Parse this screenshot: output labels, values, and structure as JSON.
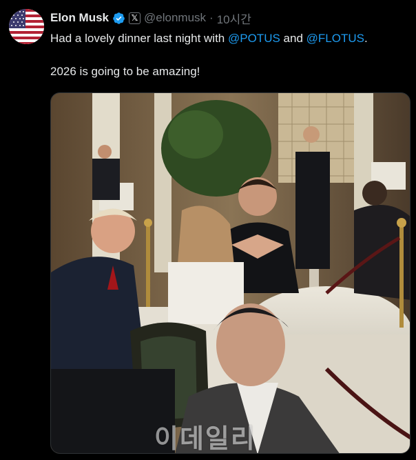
{
  "tweet": {
    "author_name": "Elon Musk",
    "handle": "@elonmusk",
    "separator": "·",
    "time": "10시간",
    "text_before": "Had a lovely dinner last night with ",
    "mention_1": "@POTUS",
    "text_and": " and ",
    "mention_2": "@FLOTUS",
    "text_end": ".",
    "line_2": "2026 is going to be amazing!"
  },
  "media": {
    "watermark": "이데일리"
  },
  "icons": {
    "avatar": "us-flag-avatar",
    "verified": "verified-badge-icon",
    "affiliate": "x-logo-icon"
  },
  "colors": {
    "background": "#000000",
    "text": "#e7e9ea",
    "secondary": "#71767b",
    "link": "#1d9bf0",
    "verified": "#1d9bf0"
  }
}
